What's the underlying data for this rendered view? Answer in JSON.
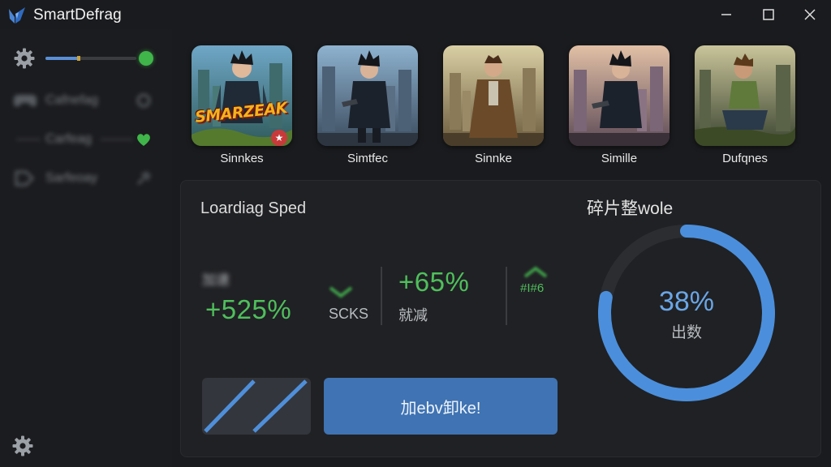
{
  "window": {
    "title": "SmartDefrag",
    "controls": {
      "minimize": "minimize-icon",
      "maximize": "maximize-icon",
      "close": "close-icon"
    }
  },
  "sidebar": {
    "slider_value": 0.37,
    "items": [
      {
        "label": "Cafnefag",
        "icon": "gamepad-icon",
        "tail_icon": "gear-icon"
      },
      {
        "label": "Carfeag",
        "icon": "none",
        "tail_icon": "heart-icon"
      },
      {
        "label": "Sarfeoay",
        "icon": "tag-icon",
        "tail_icon": "pin-icon"
      }
    ]
  },
  "games": [
    {
      "label": "Sinnkes",
      "brand": "SMARZEAK"
    },
    {
      "label": "Simtfec"
    },
    {
      "label": "Sinnke"
    },
    {
      "label": "Simille"
    },
    {
      "label": "Dufqnes"
    }
  ],
  "panel": {
    "title": "Loardiag Sped",
    "stats": [
      {
        "label": "加速",
        "value": "+525%",
        "sub": "SCKS"
      },
      {
        "value": "+65%",
        "sub": "就减"
      },
      {
        "sub": "#I#6"
      }
    ],
    "primary_button": "加ebv卸ke!"
  },
  "defrag": {
    "title": "碎片整wole",
    "percent": "38%",
    "sub": "出数",
    "progress": 0.78
  },
  "colors": {
    "accent_blue": "#3f73b3",
    "ring_blue": "#4b8fdc",
    "positive_green": "#4fbf5c",
    "status_green": "#3fb54a"
  }
}
